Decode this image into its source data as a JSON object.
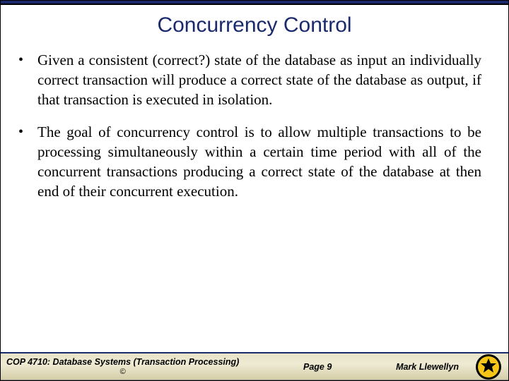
{
  "title": "Concurrency Control",
  "bullets": [
    "Given a consistent (correct?) state of the database as input an individually correct transaction will produce a correct state of the database as output, if that transaction is executed in isolation.",
    "The goal of concurrency control is to allow multiple transactions to be processing simultaneously within a certain time period with all of the concurrent transactions producing a correct state of the database at then end of their concurrent execution."
  ],
  "footer": {
    "course": "COP 4710: Database Systems  (Transaction Processing)",
    "page": "Page 9",
    "author": "Mark Llewellyn",
    "copyright": "©"
  }
}
